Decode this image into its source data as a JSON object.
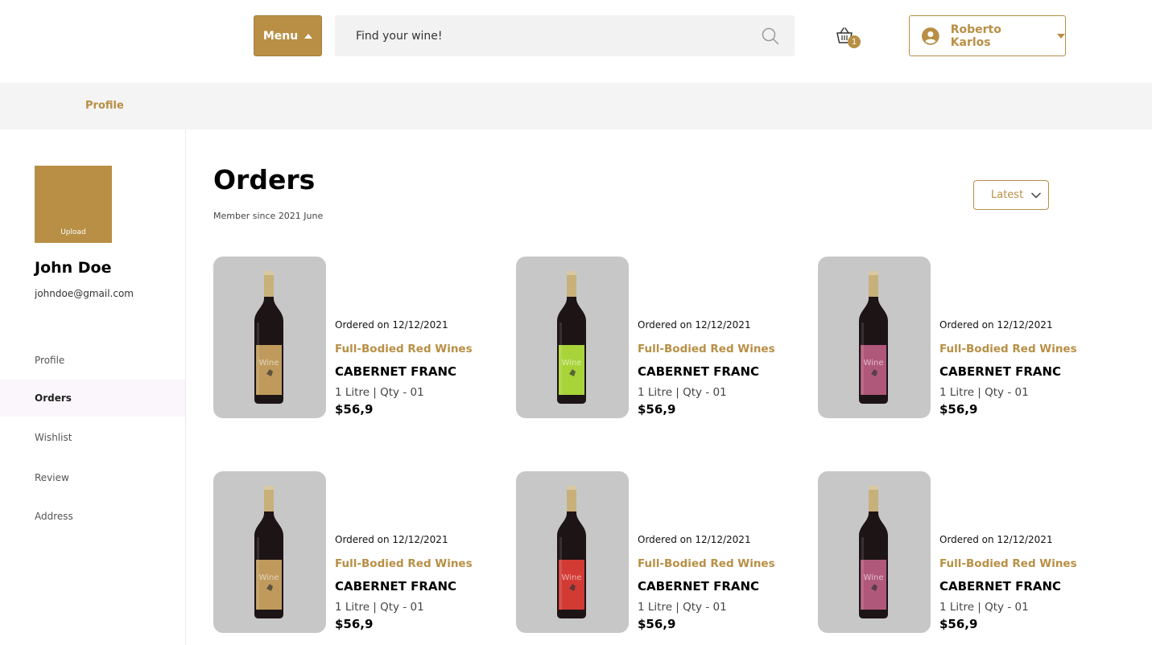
{
  "header": {
    "menu_label": "Menu",
    "search_placeholder": "Find your wine!",
    "cart_count": "1",
    "user_name": "Roberto Karlos",
    "icons": [
      "menu-caret-icon",
      "search-icon",
      "basket-icon",
      "user-circle-icon",
      "chevron-down-icon"
    ]
  },
  "breadcrumb": {
    "current": "Profile"
  },
  "sidebar": {
    "avatar_upload_label": "Upload",
    "name": "John Doe",
    "email": "johndoe@gmail.com",
    "items": [
      {
        "label": "Profile",
        "active": false
      },
      {
        "label": "Orders",
        "active": true
      },
      {
        "label": "Wishlist",
        "active": false
      },
      {
        "label": "Review",
        "active": false
      },
      {
        "label": "Address",
        "active": false
      }
    ]
  },
  "main": {
    "title": "Orders",
    "member_since": "Member since 2021 June",
    "sort_label": "Latest",
    "orders": [
      {
        "date": "Ordered on 12/12/2021",
        "category": "Full-Bodied Red Wines",
        "name": "CABERNET FRANC",
        "qty": "1 Litre | Qty - 01",
        "price": "$56,9",
        "label_color": "#bf9a5c",
        "label_text": "Wine"
      },
      {
        "date": "Ordered on 12/12/2021",
        "category": "Full-Bodied Red Wines",
        "name": "CABERNET FRANC",
        "qty": "1 Litre | Qty - 01",
        "price": "$56,9",
        "label_color": "#a8d43a",
        "label_text": "Wine"
      },
      {
        "date": "Ordered on 12/12/2021",
        "category": "Full-Bodied Red Wines",
        "name": "CABERNET FRANC",
        "qty": "1 Litre | Qty - 01",
        "price": "$56,9",
        "label_color": "#b0587a",
        "label_text": "Wine"
      },
      {
        "date": "Ordered on 12/12/2021",
        "category": "Full-Bodied Red Wines",
        "name": "CABERNET FRANC",
        "qty": "1 Litre | Qty - 01",
        "price": "$56,9",
        "label_color": "#bf9a5c",
        "label_text": "Wine"
      },
      {
        "date": "Ordered on 12/12/2021",
        "category": "Full-Bodied Red Wines",
        "name": "CABERNET FRANC",
        "qty": "1 Litre | Qty - 01",
        "price": "$56,9",
        "label_color": "#d23a34",
        "label_text": "Wine"
      },
      {
        "date": "Ordered on 12/12/2021",
        "category": "Full-Bodied Red Wines",
        "name": "CABERNET FRANC",
        "qty": "1 Litre | Qty - 01",
        "price": "$56,9",
        "label_color": "#b0587a",
        "label_text": "Wine"
      }
    ]
  },
  "colors": {
    "accent": "#b88f45",
    "panel": "#f4f4f4",
    "card_bg": "#c7c7c7"
  }
}
